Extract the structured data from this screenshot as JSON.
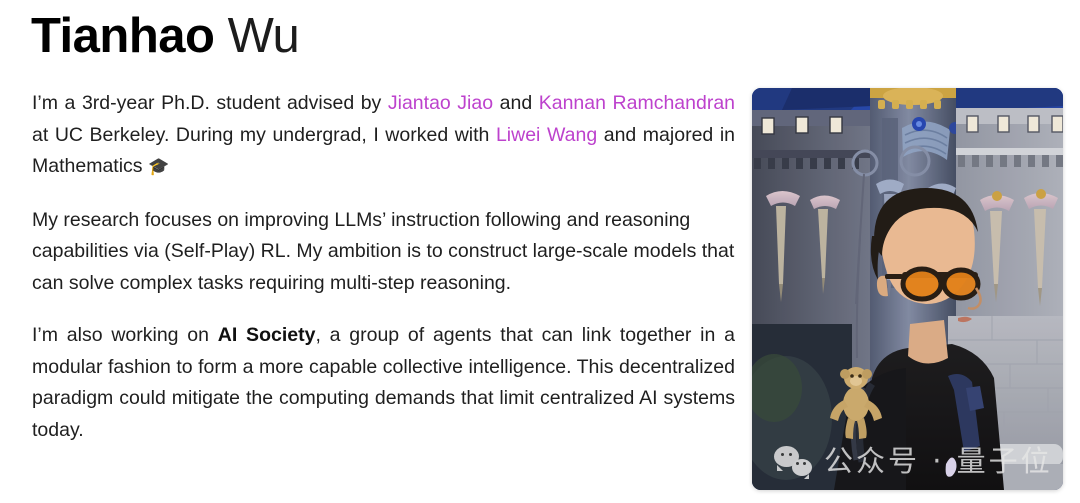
{
  "profile": {
    "given_name": "Tianhao",
    "family_name": "Wu"
  },
  "bio": {
    "p1": {
      "s1": "I’m a 3rd-year Ph.D. student advised by ",
      "link1": "Jiantao Jiao",
      "s2": " and ",
      "link2": "Kannan Ramchandran",
      "s3": " at UC Berkeley. During my undergrad, I worked with ",
      "link3": "Liwei Wang",
      "s4": " and majored in Mathematics ",
      "emoji": "🎓"
    },
    "p2": "My research focuses on improving LLMs’ instruction following and reasoning capabilities via (Self-Play) RL. My ambition is to construct large-scale models that can solve complex tasks requiring multi-step reasoning.",
    "p3": {
      "s1": "I’m also working on ",
      "bold": "AI Society",
      "s2": ", a group of agents that can link together in a modular fashion to form a more capable collective intelligence. This decentralized paradigm could mitigate the computing demands that limit centralized AI systems today."
    }
  },
  "photo": {
    "alt": "Portrait photo of Tianhao Wu in front of a blue fairytale castle, wearing amber sunglasses, a black shirt and a backpack with a small plush monkey on the strap.",
    "watermark_text": "公众号 · 量子位",
    "watermark_logo": "wechat-icon"
  },
  "colors": {
    "link": "#bd42cd",
    "text": "#1f1f1f",
    "background": "#ffffff"
  }
}
